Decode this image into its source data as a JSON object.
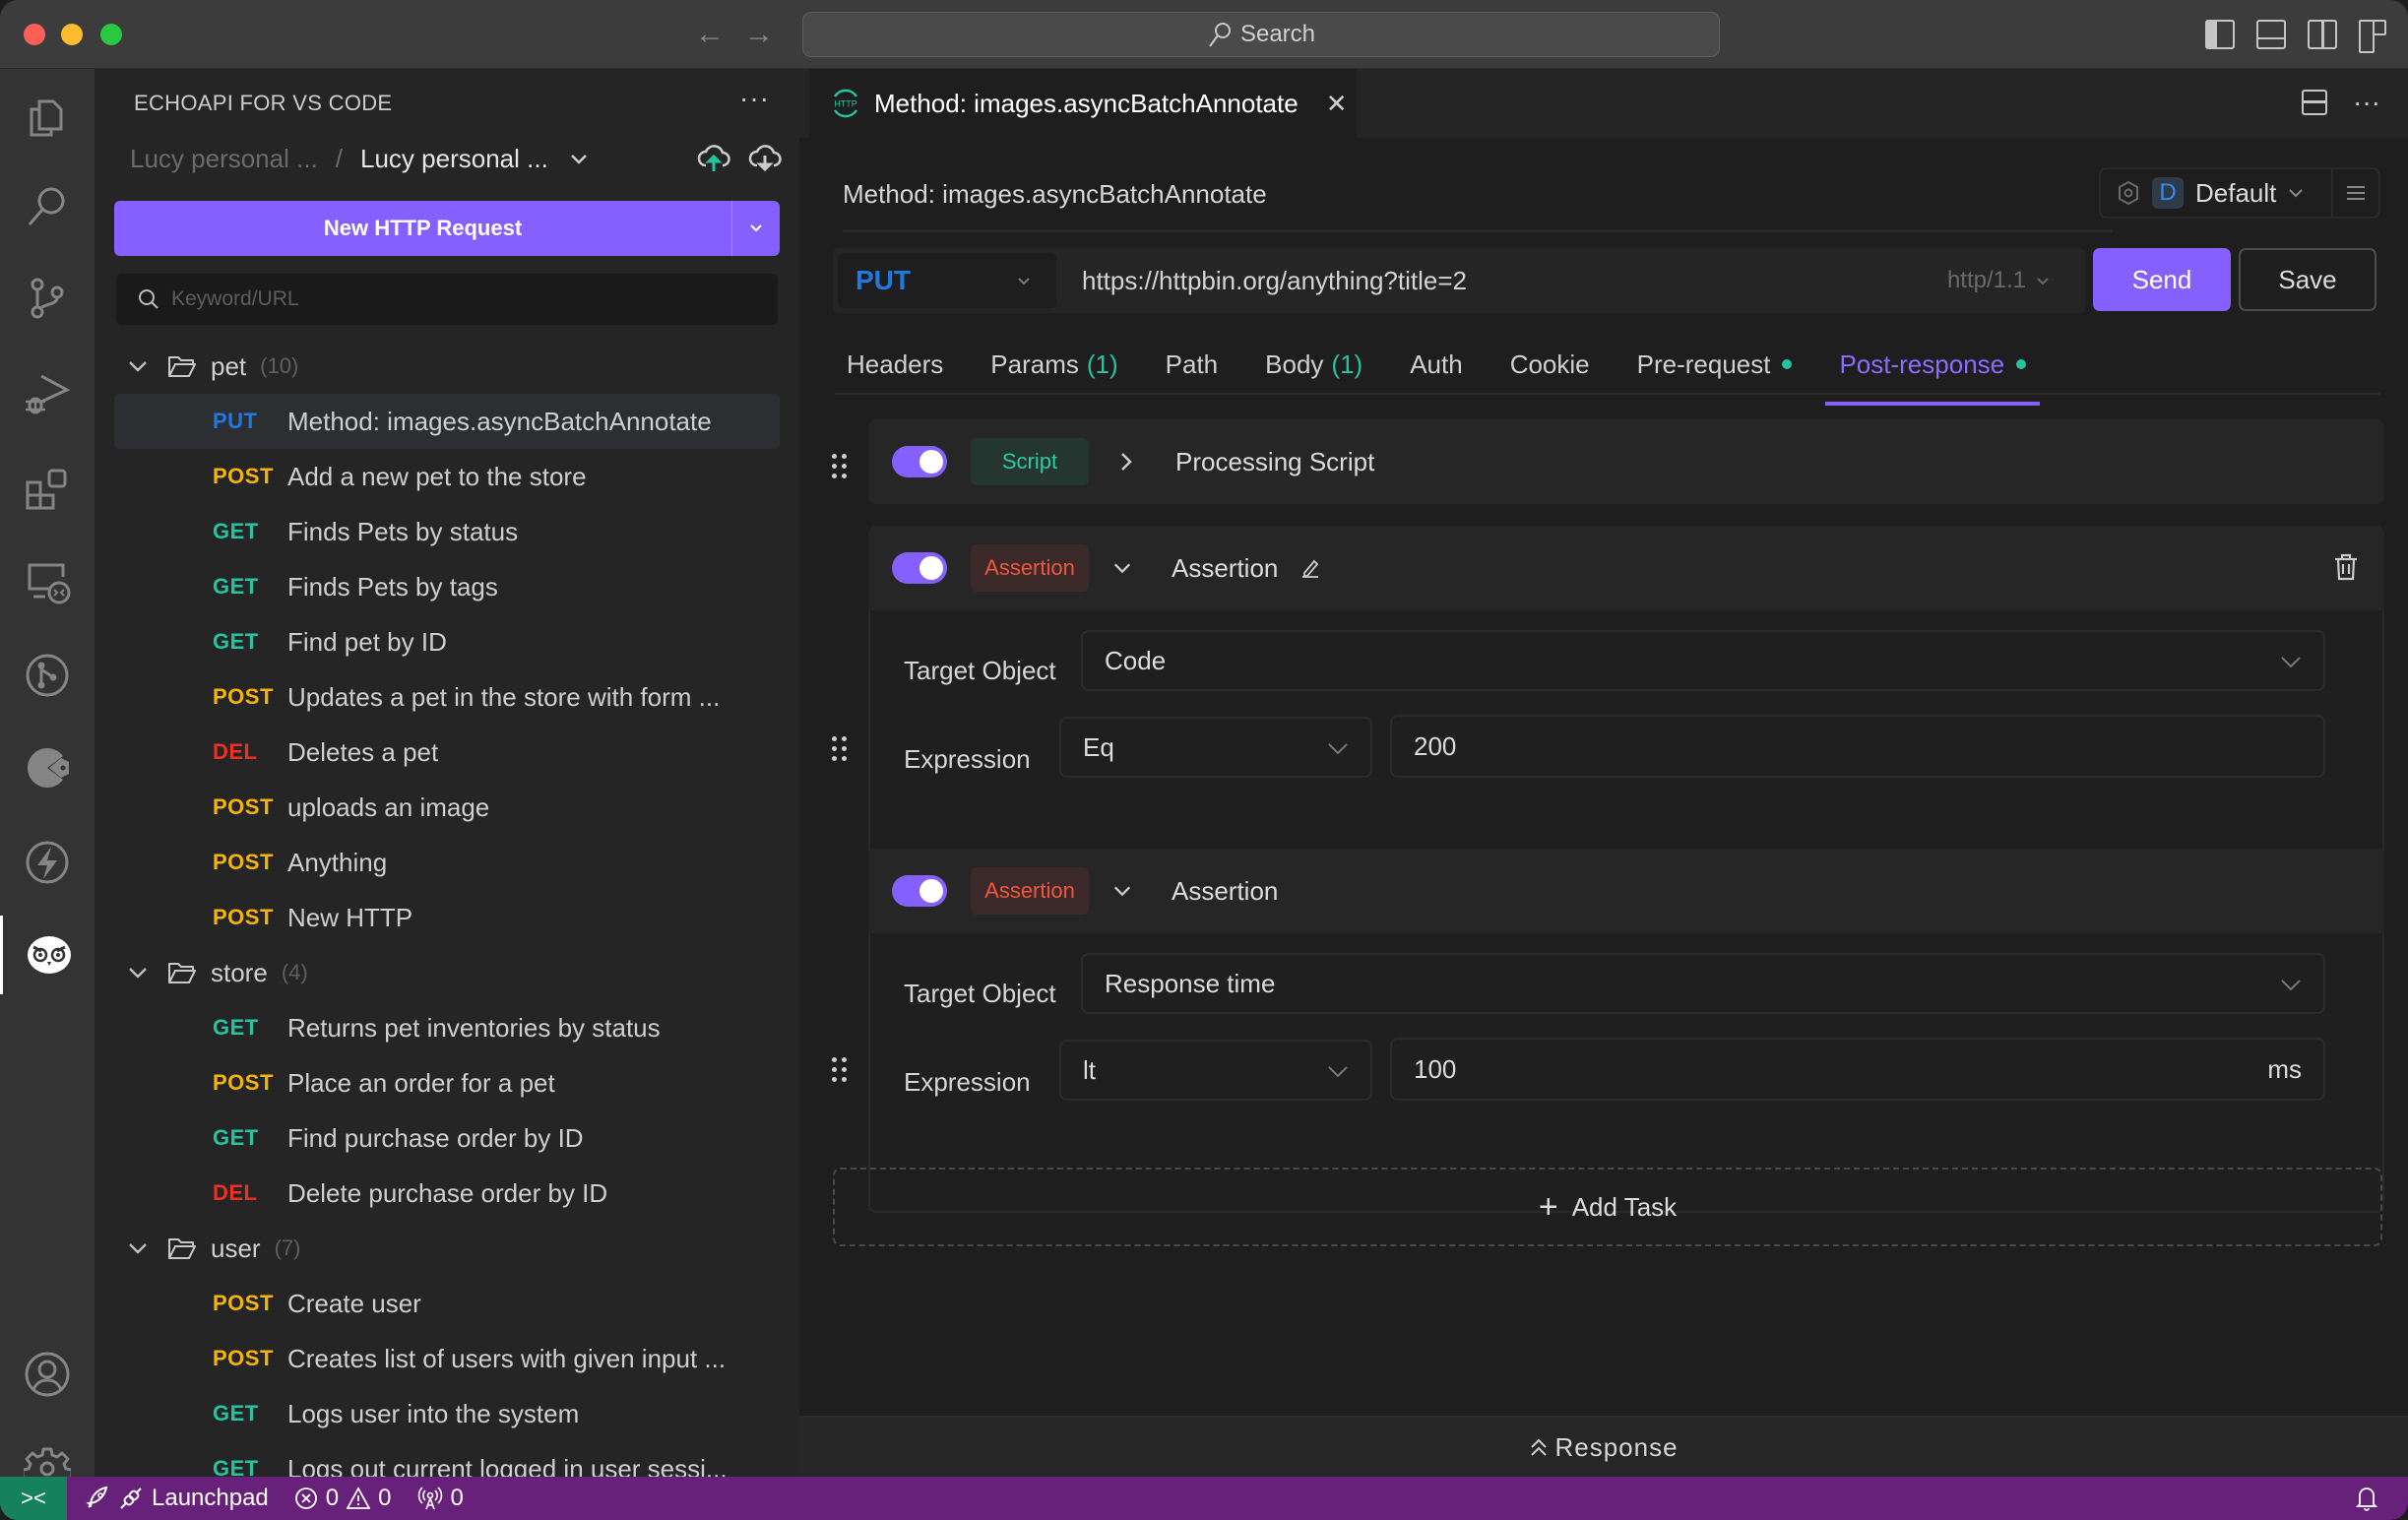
{
  "titlebar": {
    "search_placeholder": "Search",
    "back_label": "←",
    "forward_label": "→"
  },
  "activitybar": {
    "items": [
      "explorer",
      "search",
      "source-control",
      "run-debug",
      "extensions",
      "remote-explorer",
      "git-graph",
      "echoapi-analytics",
      "thunder",
      "echoapi-owl"
    ],
    "bottom": [
      "accounts",
      "settings"
    ]
  },
  "sidebar": {
    "title": "ECHOAPI FOR VS CODE",
    "more": "···",
    "breadcrumb": {
      "workspace": "Lucy personal ...",
      "separator": "/",
      "project": "Lucy personal ...",
      "chevron": "⌄"
    },
    "new_request_label": "New HTTP Request",
    "search_placeholder": "Keyword/URL",
    "folders": [
      {
        "name": "pet",
        "count": "(10)",
        "items": [
          {
            "method": "PUT",
            "name": "Method: images.asyncBatchAnnotate",
            "selected": true
          },
          {
            "method": "POST",
            "name": "Add a new pet to the store"
          },
          {
            "method": "GET",
            "name": "Finds Pets by status"
          },
          {
            "method": "GET",
            "name": "Finds Pets by tags"
          },
          {
            "method": "GET",
            "name": "Find pet by ID"
          },
          {
            "method": "POST",
            "name": "Updates a pet in the store with form ..."
          },
          {
            "method": "DEL",
            "name": "Deletes a pet"
          },
          {
            "method": "POST",
            "name": "uploads an image"
          },
          {
            "method": "POST",
            "name": "Anything"
          },
          {
            "method": "POST",
            "name": "New HTTP"
          }
        ]
      },
      {
        "name": "store",
        "count": "(4)",
        "items": [
          {
            "method": "GET",
            "name": "Returns pet inventories by status"
          },
          {
            "method": "POST",
            "name": "Place an order for a pet"
          },
          {
            "method": "GET",
            "name": "Find purchase order by ID"
          },
          {
            "method": "DEL",
            "name": "Delete purchase order by ID"
          }
        ]
      },
      {
        "name": "user",
        "count": "(7)",
        "items": [
          {
            "method": "POST",
            "name": "Create user"
          },
          {
            "method": "POST",
            "name": "Creates list of users with given input ..."
          },
          {
            "method": "GET",
            "name": "Logs user into the system"
          },
          {
            "method": "GET",
            "name": "Logs out current logged in user sessi..."
          }
        ]
      }
    ]
  },
  "method_colors": {
    "GET": "#26c3a0",
    "POST": "#f5b50a",
    "PUT": "#1f7ae0",
    "DEL": "#ee3124"
  },
  "editor": {
    "tab": {
      "title": "Method: images.asyncBatchAnnotate",
      "close": "✕"
    },
    "request_title": "Method: images.asyncBatchAnnotate",
    "environment": {
      "badge": "D",
      "name": "Default"
    },
    "method": "PUT",
    "url": "https://httpbin.org/anything?title=2",
    "http_version": "http/1.1",
    "send_label": "Send",
    "save_label": "Save",
    "tabs": [
      {
        "label": "Headers"
      },
      {
        "label": "Params",
        "count": "(1)"
      },
      {
        "label": "Path"
      },
      {
        "label": "Body",
        "count": "(1)"
      },
      {
        "label": "Auth"
      },
      {
        "label": "Cookie"
      },
      {
        "label": "Pre-request",
        "dot": true
      },
      {
        "label": "Post-response",
        "dot": true,
        "active": true
      }
    ],
    "tasks": [
      {
        "enabled": true,
        "type": "Script",
        "expanded": false,
        "name": "Processing Script"
      },
      {
        "enabled": true,
        "type": "Assertion",
        "expanded": true,
        "name": "Assertion",
        "target_label": "Target Object",
        "target_value": "Code",
        "expression_label": "Expression",
        "operator": "Eq",
        "value": "200",
        "suffix": ""
      },
      {
        "enabled": true,
        "type": "Assertion",
        "expanded": true,
        "name": "Assertion",
        "target_label": "Target Object",
        "target_value": "Response time",
        "expression_label": "Expression",
        "operator": "lt",
        "value": "100",
        "suffix": "ms"
      }
    ],
    "add_task_label": "Add Task",
    "response_label": "Response"
  },
  "statusbar": {
    "remote_icon": "><",
    "launchpad": "Launchpad",
    "errors": "0",
    "warnings": "0",
    "ports": "0"
  }
}
